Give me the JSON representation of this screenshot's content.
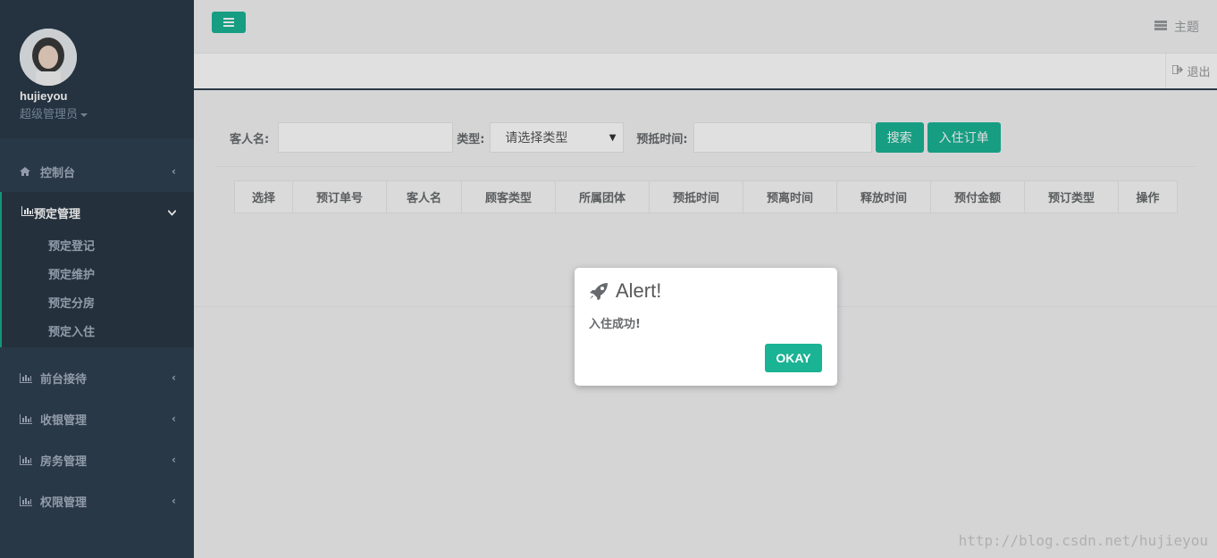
{
  "user": {
    "name": "hujieyou",
    "role": "超级管理员"
  },
  "sidebar": {
    "dashboard": "控制台",
    "reservation": {
      "label": "预定管理",
      "items": [
        "预定登记",
        "预定维护",
        "预定分房",
        "预定入住"
      ]
    },
    "others": [
      "前台接待",
      "收银管理",
      "房务管理",
      "权限管理"
    ]
  },
  "topbar": {
    "theme": "主题",
    "logout": "退出"
  },
  "search": {
    "guest_label": "客人名:",
    "type_label": "类型:",
    "type_select": "请选择类型",
    "arrive_label": "预抵时间:",
    "search_btn": "搜索",
    "checkin_btn": "入住订单"
  },
  "table": {
    "columns": [
      "选择",
      "预订单号",
      "客人名",
      "顾客类型",
      "所属团体",
      "预抵时间",
      "预离时间",
      "释放时间",
      "预付金额",
      "预订类型",
      "操作"
    ]
  },
  "dialog": {
    "title": "Alert!",
    "message": "入住成功!",
    "ok": "OKAY"
  },
  "watermark": "http://blog.csdn.net/hujieyou",
  "colors": {
    "accent": "#1ab394",
    "sidebar": "#2f4050"
  }
}
